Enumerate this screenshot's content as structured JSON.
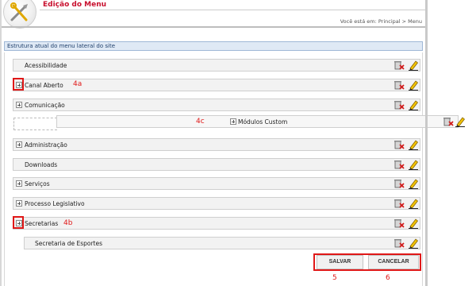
{
  "header": {
    "title": "Edição do Menu",
    "breadcrumb": "Você está em: Principal > Menu"
  },
  "section": {
    "title": "Estrutura atual do menu lateral do site"
  },
  "menu_items": [
    {
      "label": "Acessibilidade",
      "expander": false
    },
    {
      "label": "Canal Aberto",
      "expander": true,
      "annotation": "4a"
    },
    {
      "label": "Comunicação",
      "expander": true
    },
    {
      "label": "Módulos Custom",
      "expander": true,
      "annotation": "4c"
    },
    {
      "label": "Administração",
      "expander": true
    },
    {
      "label": "Downloads",
      "expander": false
    },
    {
      "label": "Serviços",
      "expander": true
    },
    {
      "label": "Processo Legislativo",
      "expander": true
    },
    {
      "label": "Secretarias",
      "expander": true,
      "annotation": "4b"
    },
    {
      "label": "Secretaria de Esportes",
      "expander": false
    }
  ],
  "buttons": {
    "save": "SALVAR",
    "cancel": "CANCELAR",
    "save_annotation": "5",
    "cancel_annotation": "6"
  },
  "colors": {
    "title_red": "#c8102e",
    "annotation_red": "#e01818",
    "pencil_yellow": "#f2c200"
  },
  "icons": {
    "delete": "trash-x-icon",
    "edit": "pencil-icon",
    "expand": "plus-square-icon"
  }
}
